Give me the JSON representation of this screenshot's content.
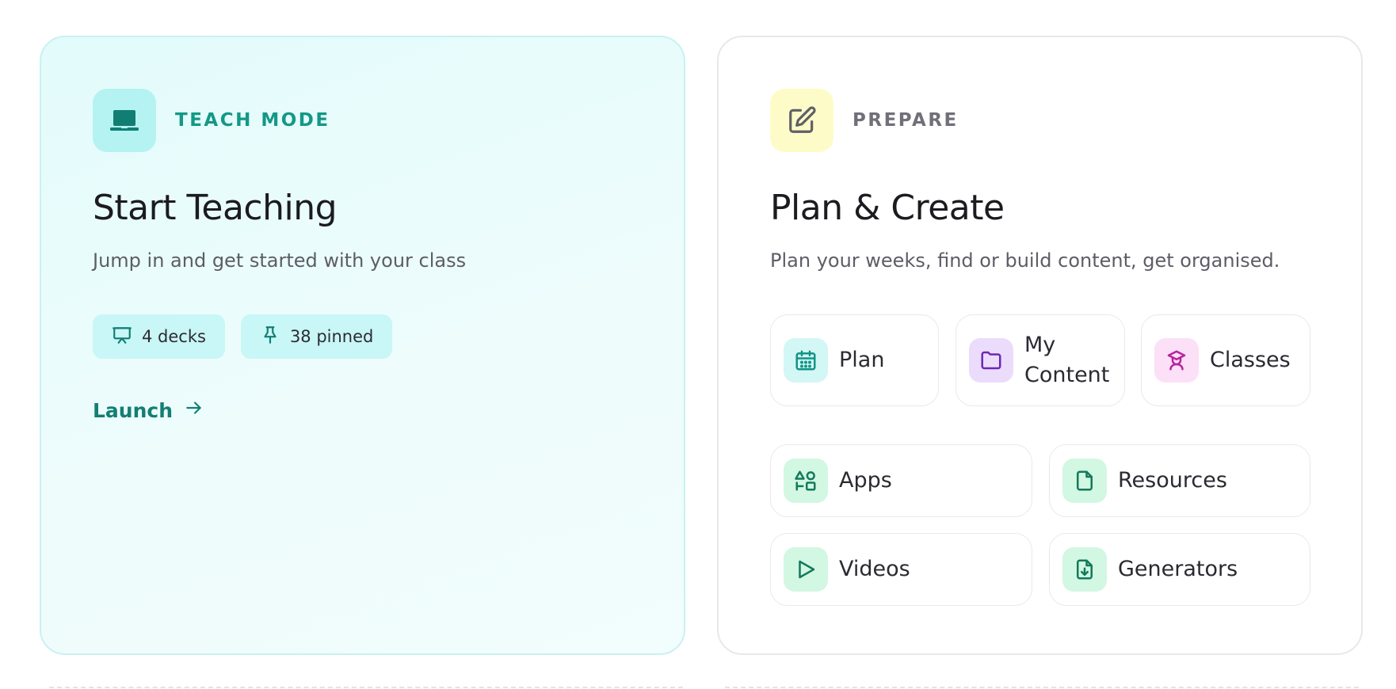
{
  "teach": {
    "eyebrow": "TEACH MODE",
    "title": "Start Teaching",
    "subtitle": "Jump in and get started with your class",
    "chips": [
      {
        "icon": "presentation-board-icon",
        "label": "4 decks"
      },
      {
        "icon": "pin-icon",
        "label": "38 pinned"
      }
    ],
    "launch_label": "Launch",
    "launch_icon": "arrow-right-icon",
    "accent": "#139886"
  },
  "prepare": {
    "eyebrow": "PREPARE",
    "title": "Plan & Create",
    "subtitle": "Plan your weeks, find or build content, get organised.",
    "tiles": [
      {
        "icon": "calendar-icon",
        "label": "Plan",
        "icon_bg": "#d3f7f5",
        "icon_color": "#129486"
      },
      {
        "icon": "folder-icon",
        "label": "My Content",
        "icon_bg": "#ecdcfb",
        "icon_color": "#6d28b5"
      },
      {
        "icon": "graduate-icon",
        "label": "Classes",
        "icon_bg": "#fbe0f7",
        "icon_color": "#b8239c"
      },
      {
        "icon": "shapes-icon",
        "label": "Apps",
        "icon_bg": "#d2f7e3",
        "icon_color": "#137a5b"
      },
      {
        "icon": "document-icon",
        "label": "Resources",
        "icon_bg": "#d2f7e3",
        "icon_color": "#137a5b"
      },
      {
        "icon": "play-icon",
        "label": "Videos",
        "icon_bg": "#d2f7e3",
        "icon_color": "#137a5b"
      },
      {
        "icon": "file-download-icon",
        "label": "Generators",
        "icon_bg": "#d2f7e3",
        "icon_color": "#137a5b"
      }
    ]
  }
}
